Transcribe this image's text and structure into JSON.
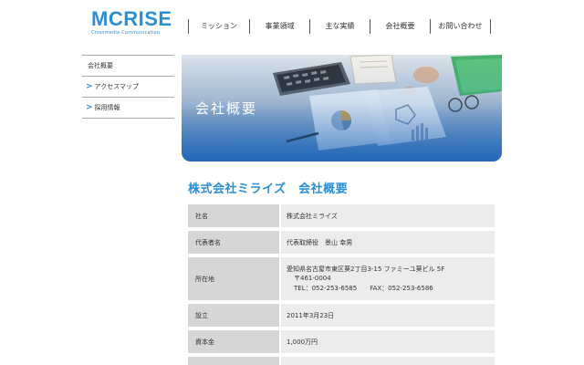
{
  "header": {
    "logo": {
      "main": "MCRISE",
      "sub": "Crossmedia Communication"
    },
    "nav": [
      {
        "label": "ミッション"
      },
      {
        "label": "事業領域"
      },
      {
        "label": "主な実績"
      },
      {
        "label": "会社概要"
      },
      {
        "label": "お問い合わせ"
      }
    ]
  },
  "sidebar": {
    "items": [
      {
        "label": "会社概要",
        "chevron": ""
      },
      {
        "label": "アクセスマップ",
        "chevron": ">"
      },
      {
        "label": "採用情報",
        "chevron": ">"
      }
    ]
  },
  "hero": {
    "title": "会社概要"
  },
  "main": {
    "heading": "株式会社ミライズ　会社概要",
    "rows": [
      {
        "label": "社名",
        "value": "株式会社ミライズ"
      },
      {
        "label": "代表者名",
        "value": "代表取締役　景山 幸男"
      },
      {
        "label": "所在地",
        "address": {
          "line1": "愛知県名古屋市東区葵2丁目3-15 ファミーユ葵ビル 5F",
          "postal": "〒461-0004",
          "tel": "TEL：052-253-6585",
          "fax": "FAX：052-253-6586"
        }
      },
      {
        "label": "設立",
        "value": "2011年3月23日"
      },
      {
        "label": "資本金",
        "value": "1,000万円"
      },
      {
        "label": "",
        "value": ""
      }
    ]
  },
  "colors": {
    "accent": "#2b8fd6",
    "label_bg": "#d6d6d6",
    "value_bg": "#ececec"
  }
}
